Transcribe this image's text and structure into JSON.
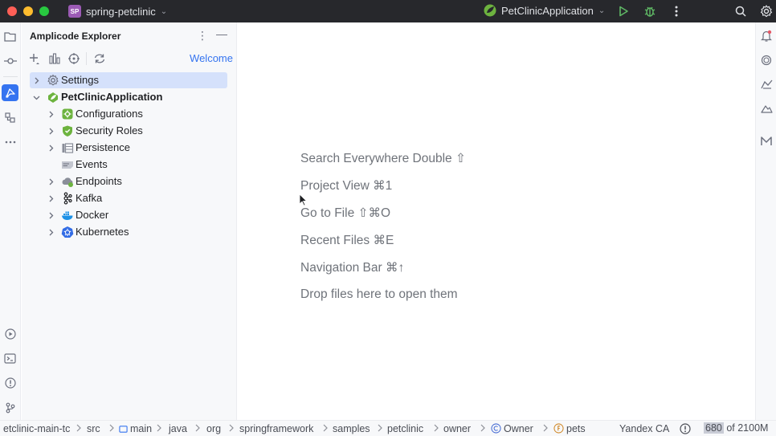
{
  "titlebar": {
    "project_badge": "SP",
    "project_name": "spring-petclinic",
    "run_config": "PetClinicApplication",
    "icons": [
      "run-icon",
      "debug-icon",
      "more-icon",
      "search-icon",
      "settings-icon"
    ]
  },
  "explorer": {
    "title": "Amplicode Explorer",
    "welcome_link": "Welcome",
    "toolbar_icons": [
      "add-icon",
      "structure-icon",
      "target-icon",
      "refresh-icon"
    ],
    "tree": [
      {
        "label": "Settings",
        "icon": "gear-icon",
        "level": 0,
        "expandable": true,
        "expanded": false,
        "selected": true,
        "bold": false
      },
      {
        "label": "PetClinicApplication",
        "icon": "spring-boot-icon",
        "level": 0,
        "expandable": true,
        "expanded": true,
        "selected": false,
        "bold": true
      },
      {
        "label": "Configurations",
        "icon": "configurations-icon",
        "level": 1,
        "expandable": true,
        "expanded": false,
        "selected": false,
        "bold": false
      },
      {
        "label": "Security Roles",
        "icon": "shield-icon",
        "level": 1,
        "expandable": true,
        "expanded": false,
        "selected": false,
        "bold": false
      },
      {
        "label": "Persistence",
        "icon": "persistence-icon",
        "level": 1,
        "expandable": true,
        "expanded": false,
        "selected": false,
        "bold": false
      },
      {
        "label": "Events",
        "icon": "events-icon",
        "level": 1,
        "expandable": false,
        "expanded": false,
        "selected": false,
        "bold": false
      },
      {
        "label": "Endpoints",
        "icon": "endpoints-icon",
        "level": 1,
        "expandable": true,
        "expanded": false,
        "selected": false,
        "bold": false
      },
      {
        "label": "Kafka",
        "icon": "kafka-icon",
        "level": 1,
        "expandable": true,
        "expanded": false,
        "selected": false,
        "bold": false
      },
      {
        "label": "Docker",
        "icon": "docker-icon",
        "level": 1,
        "expandable": true,
        "expanded": false,
        "selected": false,
        "bold": false
      },
      {
        "label": "Kubernetes",
        "icon": "kubernetes-icon",
        "level": 1,
        "expandable": true,
        "expanded": false,
        "selected": false,
        "bold": false
      }
    ]
  },
  "editor": {
    "hints": [
      "Search Everywhere Double ⇧",
      "Project View ⌘1",
      "Go to File ⇧⌘O",
      "Recent Files ⌘E",
      "Navigation Bar ⌘↑",
      "Drop files here to open them"
    ]
  },
  "statusbar": {
    "breadcrumbs": [
      {
        "label": "etclinic-main-tc",
        "icon": ""
      },
      {
        "label": "src",
        "icon": ""
      },
      {
        "label": "main",
        "icon": "folder-icon"
      },
      {
        "label": "java",
        "icon": ""
      },
      {
        "label": "org",
        "icon": ""
      },
      {
        "label": "springframework",
        "icon": ""
      },
      {
        "label": "samples",
        "icon": ""
      },
      {
        "label": "petclinic",
        "icon": ""
      },
      {
        "label": "owner",
        "icon": ""
      },
      {
        "label": "Owner",
        "icon": "class-icon"
      },
      {
        "label": "pets",
        "icon": "field-icon"
      }
    ],
    "ai_assistant": "Yandex CA",
    "memory_used": "680",
    "memory_rest": " of 2100M"
  },
  "colors": {
    "accent": "#3574f0",
    "titlebar_bg": "#27282c",
    "panel_bg": "#f7f8fa",
    "selection": "#d5e1fb"
  }
}
